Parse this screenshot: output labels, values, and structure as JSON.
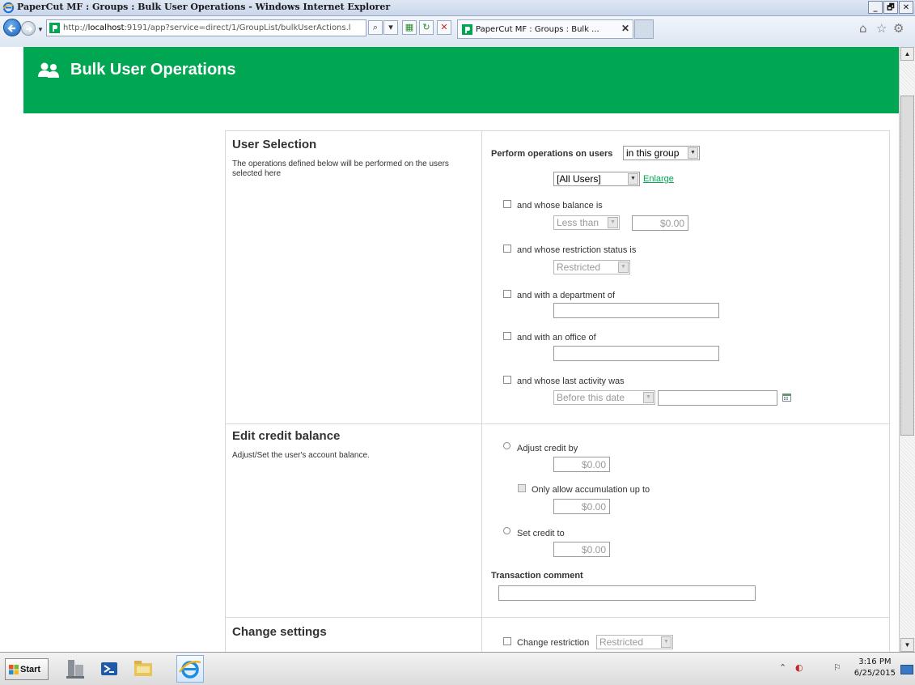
{
  "window": {
    "title": "PaperCut MF : Groups : Bulk User Operations - Windows Internet Explorer",
    "min": "_",
    "max": "🗗",
    "close": "✕"
  },
  "browser": {
    "url_prefix": "http://",
    "url_host": "localhost",
    "url_rest": ":9191/app?service=direct/1/GroupList/bulkUserActions.l",
    "tab_label": "PaperCut MF : Groups : Bulk ... ",
    "tab_close": "✕",
    "search_glyph": "⌕",
    "compat_glyph": "▾",
    "refresh_glyph": "↻",
    "stop_glyph": "✕",
    "home_glyph": "⌂",
    "fav_glyph": "☆",
    "tools_glyph": "⚙"
  },
  "page": {
    "title": "Bulk User Operations"
  },
  "user_selection": {
    "title": "User Selection",
    "description": "The operations defined below will be performed on the users selected here",
    "perform_label": "Perform operations on users",
    "scope_value": "in this group",
    "users_value": "[All Users]",
    "enlarge": "Enlarge",
    "balance_label": "and whose balance is",
    "balance_op": "Less than",
    "balance_value": "$0.00",
    "restriction_label": "and whose restriction status is",
    "restriction_value": "Restricted",
    "department_label": "and with a department of",
    "department_value": "",
    "office_label": "and with an office of",
    "office_value": "",
    "activity_label": "and whose last activity was",
    "activity_op": "Before this date",
    "activity_value": ""
  },
  "credit": {
    "title": "Edit credit balance",
    "description": "Adjust/Set the user's account balance.",
    "adjust_label": "Adjust credit by",
    "adjust_value": "$0.00",
    "accumulate_label": "Only allow accumulation up to",
    "accumulate_value": "$0.00",
    "set_label": "Set credit to",
    "set_value": "$0.00",
    "comment_label": "Transaction comment",
    "comment_value": ""
  },
  "settings": {
    "title": "Change settings",
    "restriction_label": "Change restriction",
    "restriction_value": "Restricted"
  },
  "taskbar": {
    "start": "Start",
    "time": "3:16 PM",
    "date": "6/25/2015",
    "tray_up": "⌃"
  },
  "colors": {
    "brand_green": "#00a651",
    "link_green": "#00a651"
  }
}
